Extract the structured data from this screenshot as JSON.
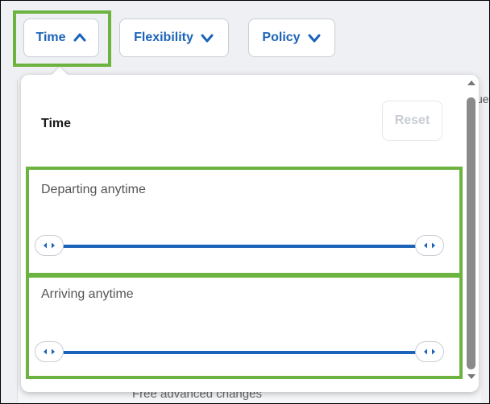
{
  "filters": [
    {
      "label": "Time",
      "chevron": "chevron-up-icon",
      "expanded": true
    },
    {
      "label": "Flexibility",
      "chevron": "chevron-down-icon",
      "expanded": false
    },
    {
      "label": "Policy",
      "chevron": "chevron-down-icon",
      "expanded": false
    }
  ],
  "background": {
    "partial_text": "ue",
    "footer_text": "Free advanced changes"
  },
  "panel": {
    "title": "Time",
    "reset_label": "Reset",
    "departing_label": "Departing anytime",
    "arriving_label": "Arriving anytime",
    "departing_range": [
      0,
      1
    ],
    "arriving_range": [
      0,
      1
    ]
  },
  "colors": {
    "accent": "#1b63b8",
    "highlight": "#6cb33f",
    "disabled": "#c9cdd3"
  }
}
